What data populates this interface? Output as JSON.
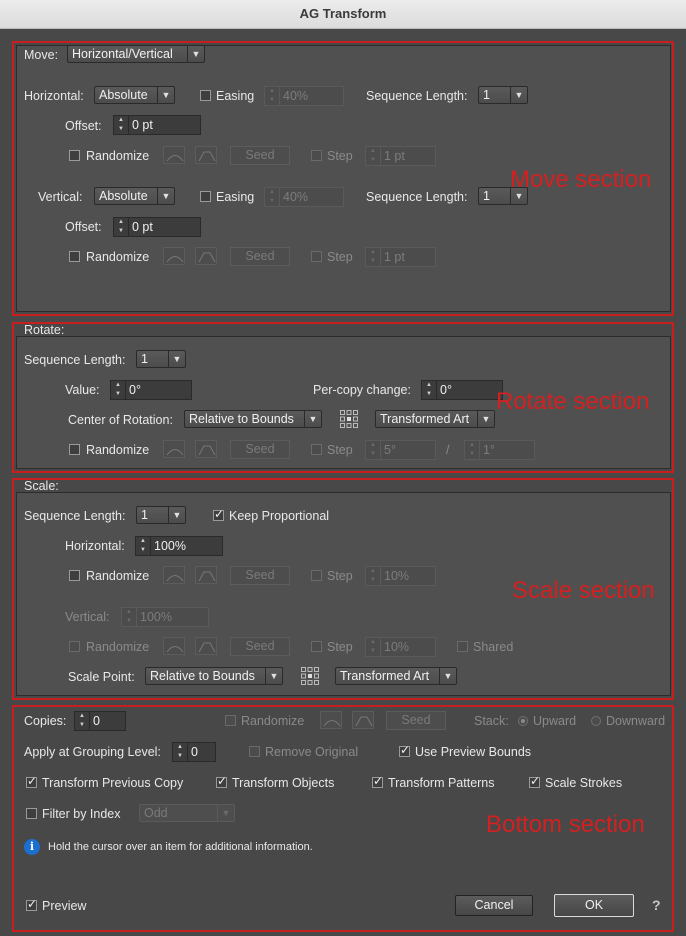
{
  "window": {
    "title": "AG Transform"
  },
  "annotations": {
    "move": "Move section",
    "rotate": "Rotate section",
    "scale": "Scale section",
    "bottom": "Bottom section",
    "color": "#c81e1e"
  },
  "move": {
    "label": "Move:",
    "mode": "Horizontal/Vertical",
    "horizontal": {
      "label": "Horizontal:",
      "type": "Absolute",
      "easing_label": "Easing",
      "easing_checked": false,
      "easing_value": "40%",
      "seq_label": "Sequence Length:",
      "seq_value": "1",
      "offset_label": "Offset:",
      "offset_value": "0 pt",
      "randomize_label": "Randomize",
      "randomize_checked": false,
      "seed_label": "Seed",
      "step_label": "Step",
      "step_value": "1 pt"
    },
    "vertical": {
      "label": "Vertical:",
      "type": "Absolute",
      "easing_label": "Easing",
      "easing_checked": false,
      "easing_value": "40%",
      "seq_label": "Sequence Length:",
      "seq_value": "1",
      "offset_label": "Offset:",
      "offset_value": "0 pt",
      "randomize_label": "Randomize",
      "randomize_checked": false,
      "seed_label": "Seed",
      "step_label": "Step",
      "step_value": "1 pt"
    }
  },
  "rotate": {
    "title": "Rotate:",
    "seq_label": "Sequence Length:",
    "seq_value": "1",
    "value_label": "Value:",
    "value": "0°",
    "per_copy_label": "Per-copy change:",
    "per_copy_value": "0°",
    "center_label": "Center of Rotation:",
    "center_value": "Relative to Bounds",
    "art_value": "Transformed Art",
    "randomize_label": "Randomize",
    "seed_label": "Seed",
    "step_label": "Step",
    "step_value": "5°",
    "slash": "/",
    "step_value2": "1°"
  },
  "scale": {
    "title": "Scale:",
    "seq_label": "Sequence Length:",
    "seq_value": "1",
    "keep_label": "Keep Proportional",
    "keep_checked": true,
    "horizontal_label": "Horizontal:",
    "horizontal_value": "100%",
    "randomize_label": "Randomize",
    "seed_label": "Seed",
    "step_label": "Step",
    "step_value": "10%",
    "vertical_label": "Vertical:",
    "vertical_value": "100%",
    "v_randomize_label": "Randomize",
    "v_seed_label": "Seed",
    "v_step_label": "Step",
    "v_step_value": "10%",
    "shared_label": "Shared",
    "point_label": "Scale Point:",
    "point_value": "Relative to Bounds",
    "art_value": "Transformed Art"
  },
  "bottom": {
    "copies_label": "Copies:",
    "copies_value": "0",
    "randomize_label": "Randomize",
    "seed_label": "Seed",
    "stack_label": "Stack:",
    "upward_label": "Upward",
    "downward_label": "Downward",
    "grouping_label": "Apply at Grouping Level:",
    "grouping_value": "0",
    "remove_original_label": "Remove Original",
    "use_preview_bounds_label": "Use Preview Bounds",
    "transform_prev_label": "Transform Previous Copy",
    "transform_objects_label": "Transform Objects",
    "transform_patterns_label": "Transform Patterns",
    "scale_strokes_label": "Scale Strokes",
    "filter_label": "Filter by Index",
    "filter_value": "Odd",
    "info_text": "Hold the cursor over an item for additional information.",
    "preview_label": "Preview",
    "cancel_label": "Cancel",
    "ok_label": "OK",
    "help_label": "?"
  }
}
